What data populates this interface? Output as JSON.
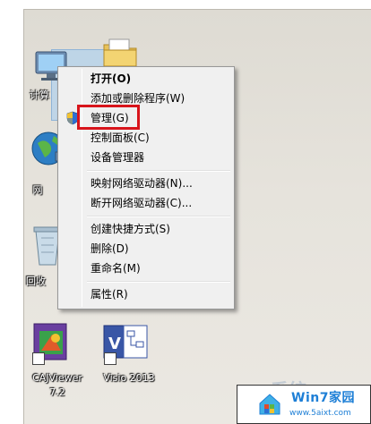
{
  "desktop": {
    "icons": [
      {
        "label": "计算机",
        "visible_label": "计算"
      },
      {
        "label": "网络",
        "visible_label": "网"
      },
      {
        "label": "回收站",
        "visible_label": "回收"
      },
      {
        "label": "CAJViewer 7.2",
        "line1": "CAJViewer",
        "line2": "7.2"
      },
      {
        "label": "Visio 2013"
      }
    ]
  },
  "context_menu": {
    "items": [
      {
        "label": "打开(O)",
        "bold": true
      },
      {
        "label": "添加或删除程序(W)"
      },
      {
        "label": "管理(G)",
        "icon": "uac-shield-icon",
        "highlighted": true
      },
      {
        "label": "控制面板(C)"
      },
      {
        "label": "设备管理器"
      },
      {
        "label": "映射网络驱动器(N)..."
      },
      {
        "label": "断开网络驱动器(C)..."
      },
      {
        "label": "创建快捷方式(S)"
      },
      {
        "label": "删除(D)"
      },
      {
        "label": "重命名(M)"
      },
      {
        "label": "属性(R)"
      }
    ]
  },
  "watermark": {
    "title": "Win7家园",
    "url": "www.5aixt.com",
    "ghost_text": "系统"
  },
  "colors": {
    "highlight_border": "#d8141b",
    "menu_background": "#f0f0f0",
    "watermark_text": "#1e7fd6"
  }
}
